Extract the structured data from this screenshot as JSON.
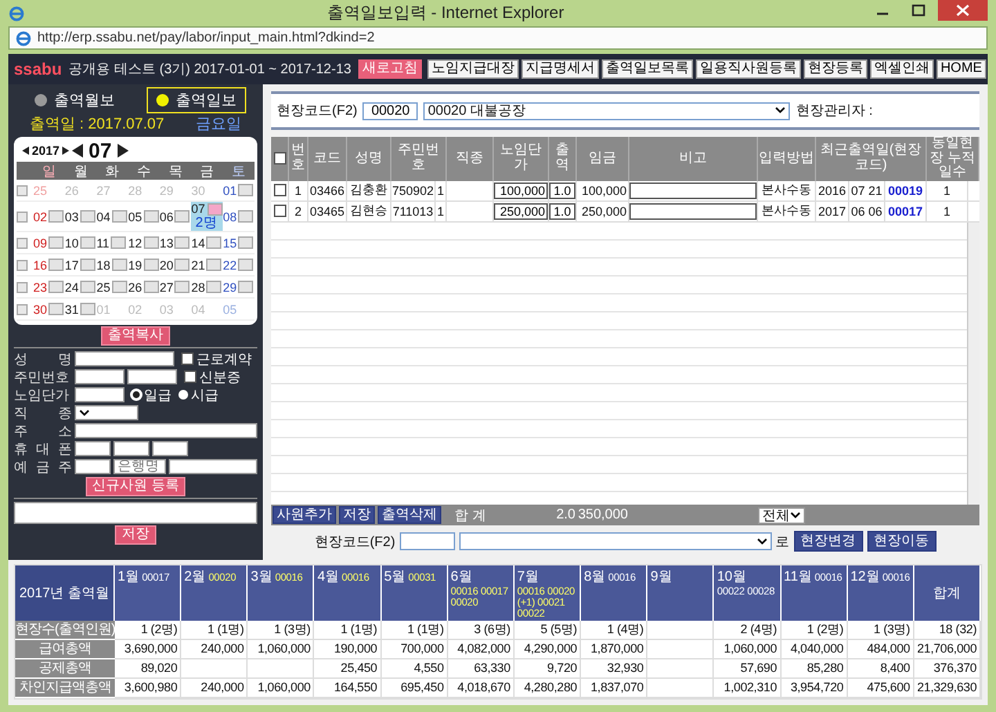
{
  "window": {
    "title": "출역일보입력 - Internet Explorer",
    "url": "http://erp.ssabu.net/pay/labor/input_main.html?dkind=2"
  },
  "header": {
    "logo": "ssabu",
    "company": "공개용 테스트 (3기) 2017-01-01 ~ 2017-12-13",
    "buttons": [
      {
        "label": "새로고침",
        "kind": "accent"
      },
      {
        "label": "노임지급대장",
        "kind": "plain"
      },
      {
        "label": "지급명세서",
        "kind": "plain"
      },
      {
        "label": "출역일보목록",
        "kind": "plain"
      },
      {
        "label": "일용직사원등록",
        "kind": "plain"
      },
      {
        "label": "현장등록",
        "kind": "plain"
      },
      {
        "label": "엑셀인쇄",
        "kind": "plain"
      },
      {
        "label": "HOME",
        "kind": "plain"
      }
    ]
  },
  "modes": [
    {
      "label": "출역월보",
      "selected": false
    },
    {
      "label": "출역일보",
      "selected": true
    }
  ],
  "work_date": {
    "label": "출역일 : 2017.07.07",
    "weekday": "금요일"
  },
  "calendar": {
    "year": "2017",
    "month": "07",
    "weekdays": [
      "일",
      "월",
      "화",
      "수",
      "목",
      "금",
      "토"
    ],
    "weeks": [
      {
        "checked": false,
        "days": [
          {
            "label": "25",
            "muted": true,
            "selected": false
          },
          {
            "label": "26",
            "muted": true,
            "selected": false
          },
          {
            "label": "27",
            "muted": true,
            "selected": false
          },
          {
            "label": "28",
            "muted": true,
            "selected": false
          },
          {
            "label": "29",
            "muted": true,
            "selected": false
          },
          {
            "label": "30",
            "muted": true,
            "selected": false
          },
          {
            "label": "01",
            "muted": false,
            "selected": false
          }
        ]
      },
      {
        "checked": false,
        "days": [
          {
            "label": "02",
            "muted": false,
            "selected": false
          },
          {
            "label": "03",
            "muted": false,
            "selected": false
          },
          {
            "label": "04",
            "muted": false,
            "selected": false
          },
          {
            "label": "05",
            "muted": false,
            "selected": false
          },
          {
            "label": "06",
            "muted": false,
            "selected": false
          },
          {
            "label": "07",
            "muted": false,
            "selected": true,
            "note": "2명"
          },
          {
            "label": "08",
            "muted": false,
            "selected": false
          }
        ]
      },
      {
        "checked": false,
        "days": [
          {
            "label": "09",
            "muted": false,
            "selected": false
          },
          {
            "label": "10",
            "muted": false,
            "selected": false
          },
          {
            "label": "11",
            "muted": false,
            "selected": false
          },
          {
            "label": "12",
            "muted": false,
            "selected": false
          },
          {
            "label": "13",
            "muted": false,
            "selected": false
          },
          {
            "label": "14",
            "muted": false,
            "selected": false
          },
          {
            "label": "15",
            "muted": false,
            "selected": false
          }
        ]
      },
      {
        "checked": false,
        "days": [
          {
            "label": "16",
            "muted": false,
            "selected": false
          },
          {
            "label": "17",
            "muted": false,
            "selected": false
          },
          {
            "label": "18",
            "muted": false,
            "selected": false
          },
          {
            "label": "19",
            "muted": false,
            "selected": false
          },
          {
            "label": "20",
            "muted": false,
            "selected": false
          },
          {
            "label": "21",
            "muted": false,
            "selected": false
          },
          {
            "label": "22",
            "muted": false,
            "selected": false
          }
        ]
      },
      {
        "checked": false,
        "days": [
          {
            "label": "23",
            "muted": false,
            "selected": false
          },
          {
            "label": "24",
            "muted": false,
            "selected": false
          },
          {
            "label": "25",
            "muted": false,
            "selected": false
          },
          {
            "label": "26",
            "muted": false,
            "selected": false
          },
          {
            "label": "27",
            "muted": false,
            "selected": false
          },
          {
            "label": "28",
            "muted": false,
            "selected": false
          },
          {
            "label": "29",
            "muted": false,
            "selected": false
          }
        ]
      },
      {
        "checked": false,
        "days": [
          {
            "label": "30",
            "muted": false,
            "selected": false
          },
          {
            "label": "31",
            "muted": false,
            "selected": false
          },
          {
            "label": "01",
            "muted": true,
            "selected": false
          },
          {
            "label": "02",
            "muted": true,
            "selected": false
          },
          {
            "label": "03",
            "muted": true,
            "selected": false
          },
          {
            "label": "04",
            "muted": true,
            "selected": false
          },
          {
            "label": "05",
            "muted": true,
            "selected": false
          }
        ]
      }
    ]
  },
  "copy_button": "출역복사",
  "form": {
    "name_label": "성 명",
    "rrn_label": "주민번호",
    "wage_label": "노임단가",
    "job_label": "직 종",
    "address_label": "주 소",
    "phone_label": "휴 대 폰",
    "holder_label": "예 금 주",
    "bank_placeholder": "은행명",
    "contract": {
      "label": "근로계약",
      "checked": false
    },
    "id_card": {
      "label": "신분증",
      "checked": false
    },
    "pay_types": [
      {
        "label": "일급",
        "selected": true
      },
      {
        "label": "시급",
        "selected": false
      }
    ],
    "register_button": "신규사원 등록"
  },
  "memo_save_button": "저장",
  "site": {
    "label": "현장코드(F2)",
    "code": "00020",
    "name": "00020  대불공장",
    "manager_label": "현장관리자 :"
  },
  "table": {
    "select_all": {
      "checked": false
    },
    "columns": [
      "번호",
      "코드",
      "성명",
      "주민번호",
      "직종",
      "노임단가",
      "출역",
      "임금",
      "비고",
      "입력방법",
      "최근출역일(현장코드)",
      "동일현장 누적일수"
    ],
    "rows": [
      {
        "checked": false,
        "no": "1",
        "code": "03466",
        "name": "김충환",
        "rrn": "750902",
        "gender": "1",
        "rate": "100,000",
        "days": "1.0",
        "wage": "100,000",
        "method": "본사수동",
        "last_year": "2016",
        "last_date": "07 21",
        "last_site": "00019",
        "cumulative": "1"
      },
      {
        "checked": false,
        "no": "2",
        "code": "03465",
        "name": "김현승",
        "rrn": "711013",
        "gender": "1",
        "rate": "250,000",
        "days": "1.0",
        "wage": "250,000",
        "method": "본사수동",
        "last_year": "2017",
        "last_date": "06 06",
        "last_site": "00017",
        "cumulative": "1"
      }
    ],
    "actions": [
      "사원추가",
      "저장",
      "출역삭제"
    ],
    "total_label": "합 계",
    "total_days": "2.0",
    "total_wage": "350,000",
    "filter": "전체"
  },
  "move": {
    "label": "현장코드(F2)",
    "suffix": "로",
    "buttons": [
      "현장변경",
      "현장이동"
    ]
  },
  "summary": {
    "corner": "2017년 출역월",
    "row_labels": [
      "현장수(출역인원)",
      "급여총액",
      "공제총액",
      "차인지급액총액"
    ],
    "months": [
      {
        "label": "1월",
        "codes": "00017",
        "color": "#ffffff",
        "sites": "1 (2명)",
        "pay": "3,690,000",
        "deduction": "89,020",
        "net": "3,600,980"
      },
      {
        "label": "2월",
        "codes": "00020",
        "color": "#ffff66",
        "sites": "1 (1명)",
        "pay": "240,000",
        "net": "240,000"
      },
      {
        "label": "3월",
        "codes": "00016",
        "color": "#ffff66",
        "sites": "1 (3명)",
        "pay": "1,060,000",
        "net": "1,060,000"
      },
      {
        "label": "4월",
        "codes": "00016",
        "color": "#ffff66",
        "sites": "1 (1명)",
        "pay": "190,000",
        "deduction": "25,450",
        "net": "164,550"
      },
      {
        "label": "5월",
        "codes": "00031",
        "color": "#ffff66",
        "sites": "1 (1명)",
        "pay": "700,000",
        "deduction": "4,550",
        "net": "695,450"
      },
      {
        "label": "6월",
        "codes": "00016 00017 00020",
        "color": "#ffff66",
        "sites": "3 (6명)",
        "pay": "4,082,000",
        "deduction": "63,330",
        "net": "4,018,670"
      },
      {
        "label": "7월",
        "codes": "00016 00020 (+1) 00021 00022",
        "color": "#ffff66",
        "sites": "5 (5명)",
        "pay": "4,290,000",
        "deduction": "9,720",
        "net": "4,280,280"
      },
      {
        "label": "8월",
        "codes": "00016",
        "color": "#ffffff",
        "sites": "1 (4명)",
        "pay": "1,870,000",
        "deduction": "32,930",
        "net": "1,837,070"
      },
      {
        "label": "9월"
      },
      {
        "label": "10월",
        "codes": "00022 00028",
        "color": "#ffffff",
        "sites": "2 (4명)",
        "pay": "1,060,000",
        "deduction": "57,690",
        "net": "1,002,310"
      },
      {
        "label": "11월",
        "codes": "00016",
        "color": "#ffffff",
        "sites": "1 (2명)",
        "pay": "4,040,000",
        "deduction": "85,280",
        "net": "3,954,720"
      },
      {
        "label": "12월",
        "codes": "00016",
        "color": "#ffffff",
        "sites": "1 (3명)",
        "pay": "484,000",
        "deduction": "8,400",
        "net": "475,600"
      }
    ],
    "total": {
      "label": "합계",
      "sites": "18 (32)",
      "pay": "21,706,000",
      "deduction": "376,370",
      "net": "21,329,630"
    }
  }
}
